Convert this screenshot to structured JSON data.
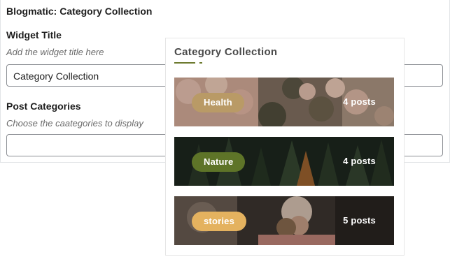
{
  "form": {
    "heading": "Blogmatic: Category Collection",
    "widget_title_label": "Widget Title",
    "widget_title_help": "Add the widget title here",
    "widget_title_value": "Category Collection",
    "post_categories_label": "Post Categories",
    "post_categories_help": "Choose the caategories to display",
    "post_categories_value": ""
  },
  "preview": {
    "title": "Category Collection",
    "accent_color": "#6d7a2f",
    "categories": [
      {
        "name": "Health",
        "count": "4 posts",
        "pill_color": "#b99a66"
      },
      {
        "name": "Nature",
        "count": "4 posts",
        "pill_color": "#5e7428"
      },
      {
        "name": "stories",
        "count": "5 posts",
        "pill_color": "#e4b25f"
      }
    ]
  }
}
